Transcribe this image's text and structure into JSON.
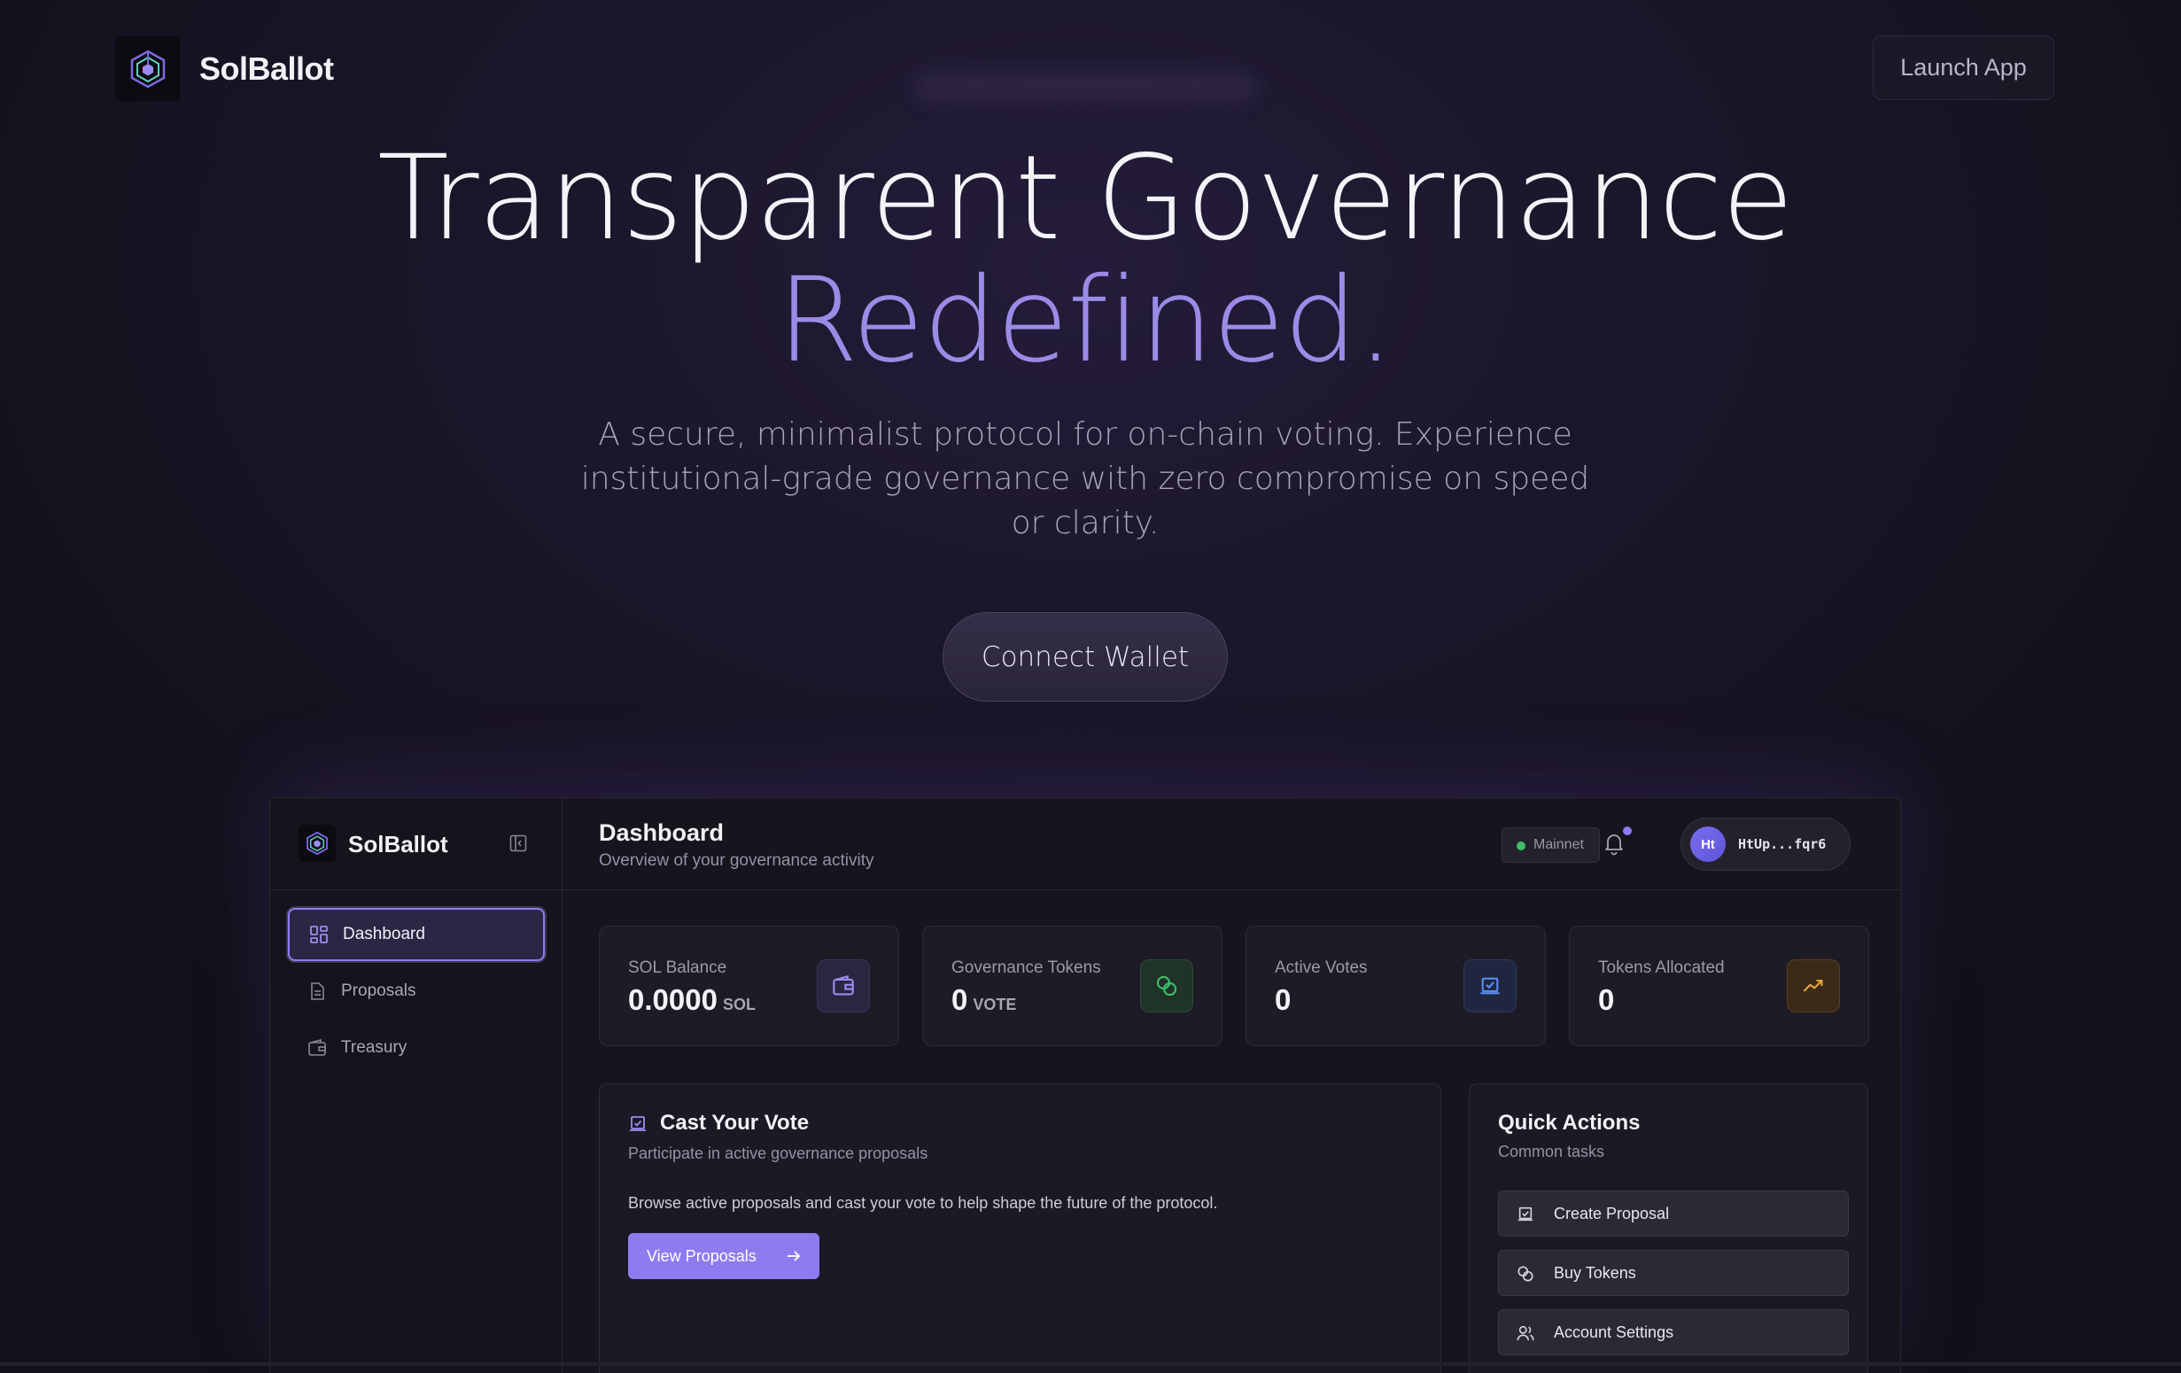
{
  "header": {
    "brand": "SolBallot",
    "launch_label": "Launch App"
  },
  "hero": {
    "title_line1": "Transparent Governance",
    "title_line2": "Redefined.",
    "subtitle": "A secure, minimalist protocol for on-chain voting. Experience institutional-grade governance with zero compromise on speed or clarity.",
    "cta_label": "Connect Wallet"
  },
  "app": {
    "brand": "SolBallot",
    "sidebar": {
      "items": [
        {
          "label": "Dashboard",
          "icon": "grid-icon",
          "active": true
        },
        {
          "label": "Proposals",
          "icon": "document-icon",
          "active": false
        },
        {
          "label": "Treasury",
          "icon": "wallet-icon",
          "active": false
        }
      ]
    },
    "topbar": {
      "title": "Dashboard",
      "subtitle": "Overview of your governance activity",
      "network": "Mainnet",
      "avatar_initials": "Ht",
      "wallet_address": "HtUp...fqr6"
    },
    "stats": [
      {
        "label": "SOL Balance",
        "value": "0.0000",
        "unit": "SOL",
        "icon": "wallet-icon",
        "accent": "#8a7cf0"
      },
      {
        "label": "Governance Tokens",
        "value": "0",
        "unit": "VOTE",
        "icon": "coins-icon",
        "accent": "#3fbf6b"
      },
      {
        "label": "Active Votes",
        "value": "0",
        "unit": "",
        "icon": "vote-icon",
        "accent": "#5b8cf0"
      },
      {
        "label": "Tokens Allocated",
        "value": "0",
        "unit": "",
        "icon": "trending-up-icon",
        "accent": "#e8a33a"
      }
    ],
    "vote_card": {
      "title": "Cast Your Vote",
      "subtitle": "Participate in active governance proposals",
      "description": "Browse active proposals and cast your vote to help shape the future of the protocol.",
      "button_label": "View Proposals"
    },
    "quick_actions": {
      "title": "Quick Actions",
      "subtitle": "Common tasks",
      "items": [
        {
          "label": "Create Proposal",
          "icon": "vote-icon"
        },
        {
          "label": "Buy Tokens",
          "icon": "coins-icon"
        },
        {
          "label": "Account Settings",
          "icon": "users-icon"
        }
      ]
    }
  },
  "colors": {
    "accent": "#8d7cf0",
    "hero_accent": "#9c8be6",
    "background": "#16141d"
  }
}
